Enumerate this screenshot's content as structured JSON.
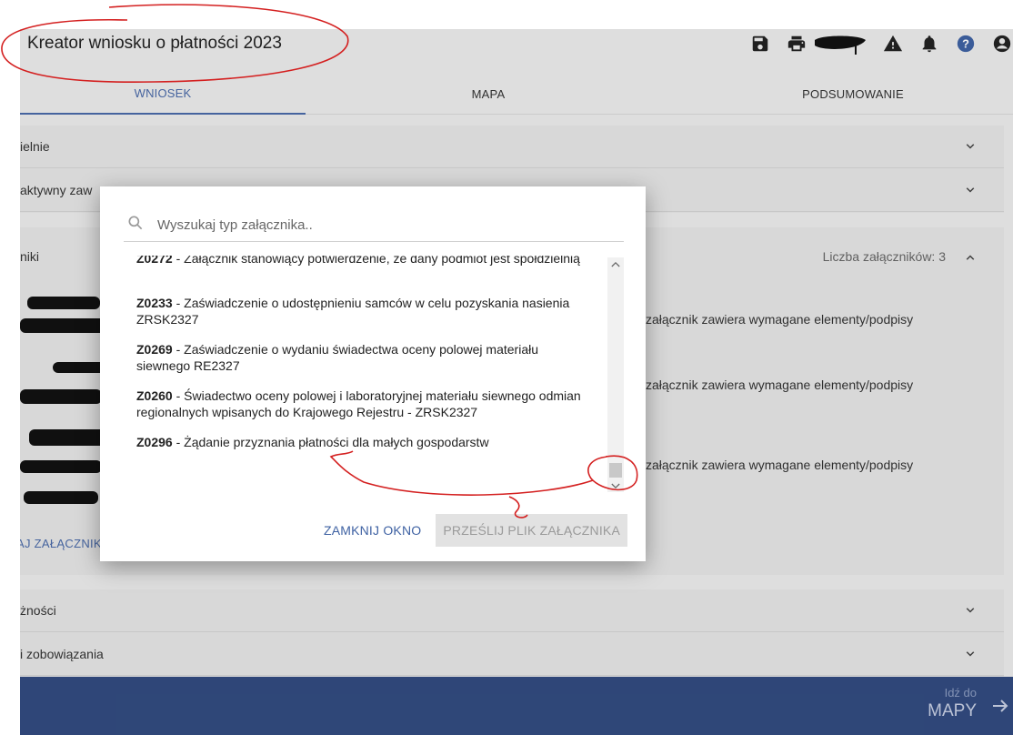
{
  "header": {
    "title": "Kreator wniosku o płatności 2023",
    "icons": [
      "save-icon",
      "print-icon",
      "warning-icon",
      "bell-icon",
      "help-icon",
      "account-icon"
    ]
  },
  "tabs": [
    {
      "label": "WNIOSEK",
      "active": true
    },
    {
      "label": "MAPA",
      "active": false
    },
    {
      "label": "PODSUMOWANIE",
      "active": false
    }
  ],
  "sections": {
    "row1": "ielnie",
    "row2": "aktywny zaw",
    "attachments_label": "niki",
    "attachments_count": "Liczba załączników: 3",
    "requirement_text": "załącznik zawiera wymagane elementy/podpisy",
    "add_attachment": "AJ ZAŁĄCZNIK",
    "row_payments": "żności",
    "row_obligations": "i zobowiązania"
  },
  "bottom_bar": {
    "go_small": "Idź do",
    "go_big": "MAPY"
  },
  "dialog": {
    "search_placeholder": "Wyszukaj typ załącznika..",
    "items": [
      {
        "code": "Z0272",
        "text": " - Załącznik stanowiący potwierdzenie, że dany podmiot jest spółdzielnią"
      },
      {
        "code": "Z0233",
        "text": " - Zaświadczenie o udostępnieniu samców w celu pozyskania nasienia ZRSK2327"
      },
      {
        "code": "Z0269",
        "text": " - Zaświadczenie o wydaniu świadectwa oceny polowej materiału siewnego RE2327"
      },
      {
        "code": "Z0260",
        "text": " - Świadectwo oceny polowej i laboratoryjnej materiału siewnego odmian regionalnych wpisanych do Krajowego Rejestru - ZRSK2327"
      },
      {
        "code": "Z0296",
        "text": " - Żądanie przyznania płatności dla małych gospodarstw"
      }
    ],
    "close_label": "ZAMKNIJ OKNO",
    "send_label": "PRZEŚLIJ PLIK ZAŁĄCZNIKA"
  },
  "colors": {
    "accent": "#4a6aa8",
    "bottom_bar": "#324b80",
    "annotation": "#d42020"
  }
}
